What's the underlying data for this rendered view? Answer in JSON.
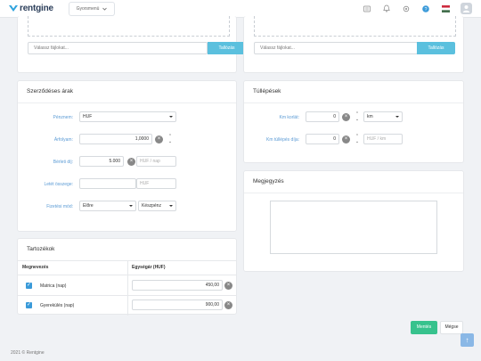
{
  "header": {
    "logo_text": "rentgine",
    "quick_menu_label": "Gyorsmenü",
    "icons": [
      "document-icon",
      "bell-icon",
      "settings-icon",
      "help-icon",
      "flag-hu-icon",
      "user-avatar-icon"
    ],
    "flag_colors": [
      "#cd2a3e",
      "#ffffff",
      "#436f4d"
    ],
    "accent": "#2ea3dd"
  },
  "upload_left": {
    "placeholder": "Válassz fájlokat...",
    "button": "Tallózás"
  },
  "upload_right": {
    "placeholder": "Válassz fájlokat...",
    "button": "Tallózás"
  },
  "contract_prices": {
    "title": "Szerződéses árak",
    "currency": {
      "label": "Pénznem:",
      "value": "HUF"
    },
    "exchange_rate": {
      "label": "Árfolyam:",
      "value": "1,0000"
    },
    "rental_fee": {
      "label": "Bérleti díj:",
      "value": "5.000",
      "unit_placeholder": "HUF / nap"
    },
    "deposit": {
      "label": "Letét összege:",
      "unit_placeholder": "HUF"
    },
    "payment_mode": {
      "label": "Fizetési mód:",
      "timing": "Előre",
      "method": "Készpénz"
    }
  },
  "overage": {
    "title": "Túllépések",
    "km_limit": {
      "label": "Km korlát:",
      "value": "0",
      "unit": "km"
    },
    "km_overage_fee": {
      "label": "Km túllépés díja:",
      "value": "0",
      "unit_placeholder": "HUF / km"
    }
  },
  "notes": {
    "title": "Megjegyzés"
  },
  "accessories": {
    "title": "Tartozékok",
    "columns": [
      "Megnevezés",
      "Egységár (HUF)"
    ],
    "rows": [
      {
        "name": "Matrica (nap)",
        "price": "450,00",
        "checked": true
      },
      {
        "name": "Gyerekülés (nap)",
        "price": "900,00",
        "checked": true
      }
    ]
  },
  "actions": {
    "save": "Mentés",
    "cancel": "Mégse"
  },
  "footer": {
    "copyright": "2021 © Rentgine"
  }
}
